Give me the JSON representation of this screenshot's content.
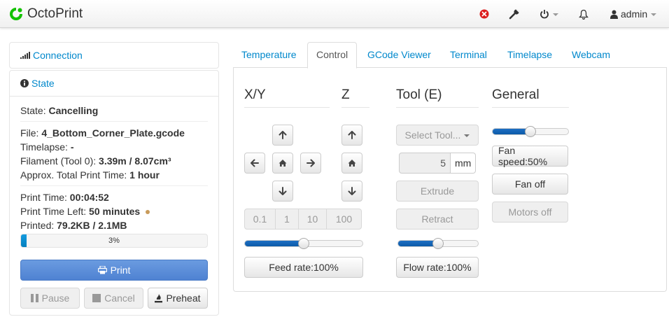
{
  "navbar": {
    "brand": "OctoPrint",
    "user": "admin",
    "colors": {
      "error": "#dc1e1e",
      "brand_green": "#13c100"
    }
  },
  "sidebar": {
    "connection_label": "Connection",
    "state_label": "State",
    "state": {
      "label": "State:",
      "value": "Cancelling"
    },
    "file": {
      "label": "File:",
      "value": "4_Bottom_Corner_Plate.gcode"
    },
    "timelapse": {
      "label": "Timelapse:",
      "value": "-"
    },
    "filament": {
      "label": "Filament (Tool 0):",
      "value": "3.39m / 8.07cm³"
    },
    "approx_time": {
      "label": "Approx. Total Print Time:",
      "value": "1 hour"
    },
    "print_time": {
      "label": "Print Time:",
      "value": "00:04:52"
    },
    "time_left": {
      "label": "Print Time Left:",
      "value": "50 minutes"
    },
    "printed": {
      "label": "Printed:",
      "value": "79.2KB / 2.1MB"
    },
    "progress": {
      "percent": 3,
      "text": "3%"
    },
    "buttons": {
      "print": "Print",
      "pause": "Pause",
      "cancel": "Cancel",
      "preheat": "Preheat"
    }
  },
  "tabs": [
    "Temperature",
    "Control",
    "GCode Viewer",
    "Terminal",
    "Timelapse",
    "Webcam"
  ],
  "control": {
    "xy_title": "X/Y",
    "z_title": "Z",
    "tool_title": "Tool (E)",
    "general_title": "General",
    "steps": [
      "0.1",
      "1",
      "10",
      "100"
    ],
    "feed_rate": {
      "label": "Feed rate:100%",
      "value": 0.5
    },
    "select_tool": "Select Tool...",
    "extrude_amount": "5",
    "extrude_unit": "mm",
    "extrude": "Extrude",
    "retract": "Retract",
    "flow_rate": {
      "label": "Flow rate:100%",
      "value": 0.5
    },
    "fan_speed": {
      "label": "Fan speed:50%",
      "value": 0.5
    },
    "fan_off": "Fan off",
    "motors_off": "Motors off"
  }
}
